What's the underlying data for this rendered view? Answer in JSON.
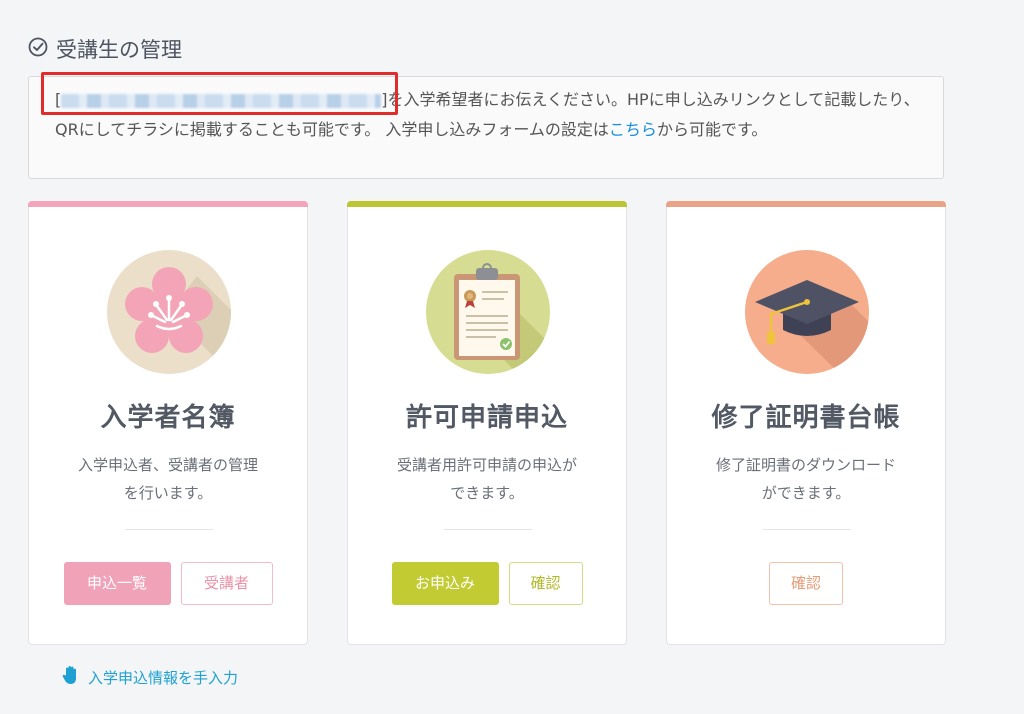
{
  "section": {
    "title": "受講生の管理"
  },
  "info": {
    "bracket_open": "[",
    "bracket_close": "]",
    "text_after_url": "を入学希望者にお伝えください。HPに申し込みリンクとして記載したり、QRにしてチラシに掲載することも可能です。 入学申し込みフォームの設定は",
    "link_text": "こちら",
    "text_end": "から可能です。"
  },
  "cards": [
    {
      "title": "入学者名簿",
      "desc_line1": "入学申込者、受講者の管理",
      "desc_line2": "を行います。",
      "buttons": [
        "申込一覧",
        "受講者"
      ],
      "accent": "#f2a5bb",
      "icon": "cherry-blossom-icon"
    },
    {
      "title": "許可申請申込",
      "desc_line1": "受講者用許可申請の申込が",
      "desc_line2": "できます。",
      "buttons": [
        "お申込み",
        "確認"
      ],
      "accent": "#bcc534",
      "icon": "clipboard-certificate-icon"
    },
    {
      "title": "修了証明書台帳",
      "desc_line1": "修了証明書のダウンロード",
      "desc_line2": "ができます。",
      "buttons": [
        "確認"
      ],
      "accent": "#e9a487",
      "icon": "graduation-cap-icon"
    }
  ],
  "manual_link": {
    "label": "入学申込情報を手入力",
    "icon": "hand-icon"
  },
  "colors": {
    "link": "#1a8ee0",
    "highlight_border": "#e12c2c"
  }
}
